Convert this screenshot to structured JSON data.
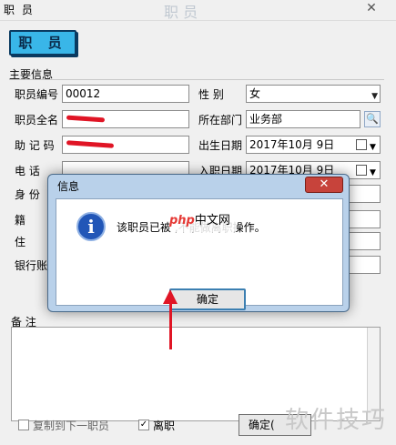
{
  "window": {
    "title": "职 员",
    "close_glyph": "✕",
    "ghost_title": "职  员"
  },
  "header_button": "职  员",
  "section": {
    "legend": "主要信息"
  },
  "fields": {
    "employee_no_label": "职员编号",
    "employee_no_value": "00012",
    "full_name_label": "职员全名",
    "mnemonic_label": "助 记 码",
    "phone_label": "电   话",
    "id_label": "身 份",
    "origin_label": "籍",
    "address_label": "住",
    "bank_label": "银行账",
    "gender_label": "性   别",
    "gender_value": "女",
    "department_label": "所在部门",
    "department_value": "业务部",
    "birth_label": "出生日期",
    "birth_value": "2017年10月  9日",
    "entry_label": "入职日期",
    "entry_value": "2017年10月  9日"
  },
  "notes_label": "备   注",
  "footer": {
    "copy_next_label": "复制到下一职员",
    "resigned_label": "离职",
    "resigned_checked": true,
    "confirm_label": "确定("
  },
  "dialog": {
    "title": "信息",
    "close_glyph": "✕",
    "icon_glyph": "i",
    "message": "该职员已被                      ,不能做离职操作。",
    "ok_label": "确定",
    "watermark_brand": "php",
    "watermark_text": "中文网"
  },
  "watermark": "软件技巧",
  "annotation": {
    "color": "#e01525"
  }
}
